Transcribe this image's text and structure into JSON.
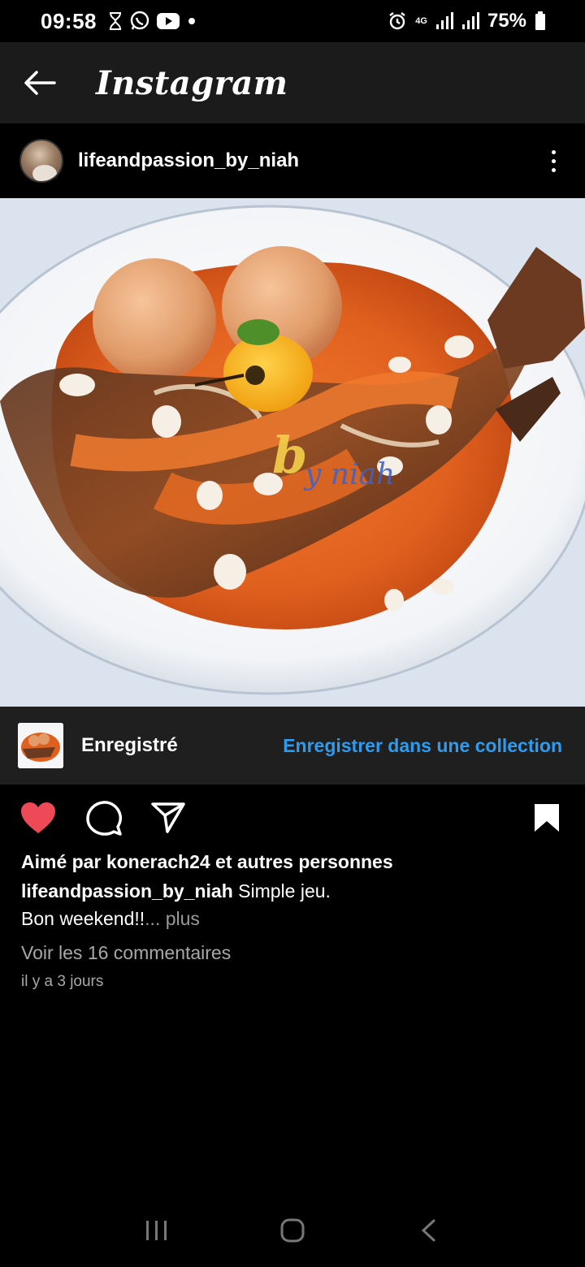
{
  "status_bar": {
    "time": "09:58",
    "battery": "75%",
    "network": "4G"
  },
  "app_bar": {
    "title": "Instagram"
  },
  "post": {
    "username": "lifeandpassion_by_niah",
    "image_watermark": "by niah",
    "saved_label": "Enregistré",
    "save_to_collection": "Enregistrer dans une collection",
    "liked_by": "Aimé par konerach24 et autres personnes",
    "caption_user": "lifeandpassion_by_niah",
    "caption_text": " Simple jeu.",
    "caption_line2": "Bon weekend!!",
    "more": "... plus",
    "comments": "Voir les 16 commentaires",
    "timestamp": "il y a 3 jours"
  },
  "colors": {
    "like_red": "#ed4956",
    "link_blue": "#2d9cf0",
    "background": "#000000"
  },
  "icons": {
    "back": "arrow-left-icon",
    "more": "more-vertical-icon",
    "like": "heart-icon",
    "comment": "comment-icon",
    "share": "send-icon",
    "save": "bookmark-icon"
  }
}
